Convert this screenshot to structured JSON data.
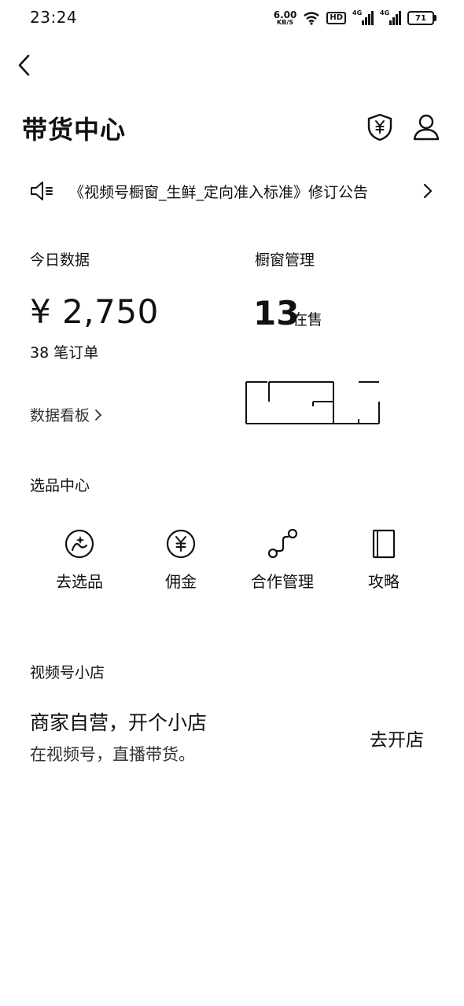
{
  "status": {
    "time": "23:24",
    "net_speed": "6.00",
    "net_unit": "KB/S",
    "hd": "HD",
    "signal1_label": "4G",
    "signal2_label": "4G",
    "battery": "71"
  },
  "header": {
    "title": "带货中心",
    "icons": [
      "back-arrow-icon",
      "shield-yen-icon",
      "person-icon"
    ]
  },
  "notice": {
    "text": "《视频号橱窗_生鲜_定向准入标准》修订公告"
  },
  "today": {
    "label": "今日数据",
    "amount": "¥ 2,750",
    "orders": "38 笔订单",
    "dashboard_link": "数据看板"
  },
  "window_mgmt": {
    "label": "橱窗管理",
    "on_sale_count": "13",
    "on_sale_unit": "在售"
  },
  "select_center": {
    "label": "选品中心",
    "items": [
      {
        "label": "去选品",
        "icon": "pick-product-icon"
      },
      {
        "label": "佣金",
        "icon": "yen-circle-icon"
      },
      {
        "label": "合作管理",
        "icon": "cooperation-icon"
      },
      {
        "label": "攻略",
        "icon": "book-icon"
      }
    ]
  },
  "shop": {
    "label": "视频号小店",
    "title": "商家自营，开个小店",
    "subtitle": "在视频号，直播带货。",
    "action": "去开店"
  }
}
